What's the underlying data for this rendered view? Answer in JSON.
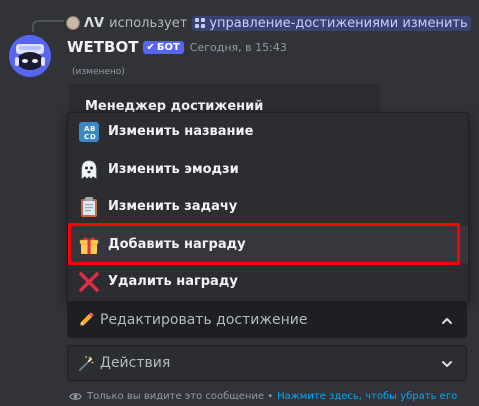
{
  "reply": {
    "username": "ɅV",
    "uses_text": "использует",
    "command": "управление-достижениями изменить"
  },
  "message": {
    "bot_name": "WETBOT",
    "bot_badge": "БОТ",
    "timestamp": "Сегодня, в 15:43",
    "edited": "(изменено)"
  },
  "embed": {
    "title": "Менеджер достижений"
  },
  "menu": {
    "options": [
      {
        "label": "Изменить название",
        "icon": "abcd-icon"
      },
      {
        "label": "Изменить эмодзи",
        "icon": "ghost-icon"
      },
      {
        "label": "Изменить задачу",
        "icon": "clipboard-icon"
      },
      {
        "label": "Добавить награду",
        "icon": "gift-icon"
      },
      {
        "label": "Удалить награду",
        "icon": "cross-icon"
      }
    ]
  },
  "selects": {
    "edit": {
      "label": "Редактировать достижение",
      "icon": "pencil-icon"
    },
    "actions": {
      "label": "Действия",
      "icon": "magic-wand-icon"
    }
  },
  "footer": {
    "text": "Только вы видите это сообщение •",
    "link": "Нажмите здесь, чтобы убрать его"
  },
  "colors": {
    "background": "#313338",
    "blurple": "#5865f2",
    "highlight": "#ff0000",
    "link": "#00a8fc"
  }
}
